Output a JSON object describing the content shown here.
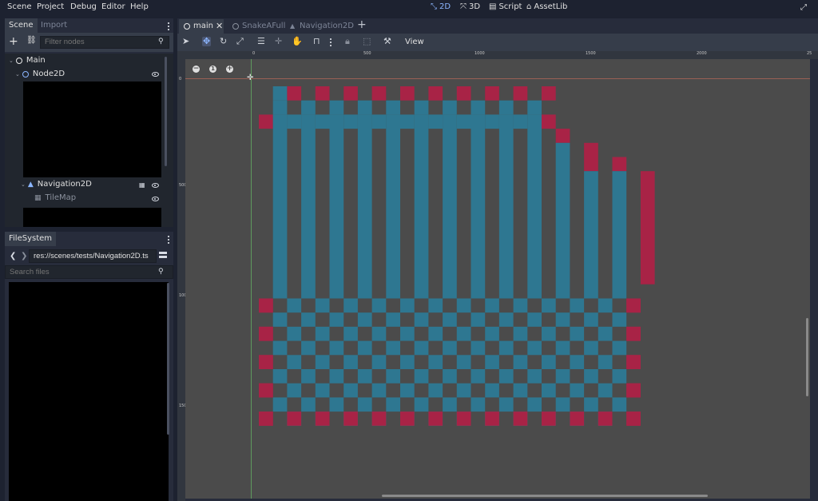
{
  "menubar": {
    "items": [
      "Scene",
      "Project",
      "Debug",
      "Editor",
      "Help"
    ],
    "workspaces": [
      {
        "label": "2D",
        "icon": "2d-icon",
        "active": true
      },
      {
        "label": "3D",
        "icon": "3d-icon",
        "active": false
      },
      {
        "label": "Script",
        "icon": "script-icon",
        "active": false
      },
      {
        "label": "AssetLib",
        "icon": "assetlib-icon",
        "active": false
      }
    ]
  },
  "scene_dock": {
    "tabs": [
      "Scene",
      "Import"
    ],
    "filter_placeholder": "Filter nodes",
    "tree": [
      {
        "label": "Main",
        "icon": "node-icon"
      },
      {
        "label": "Node2D",
        "icon": "node2d-icon"
      },
      {
        "label": "Navigation2D",
        "icon": "navigation2d-icon"
      },
      {
        "label": "TileMap",
        "icon": "tilemap-icon"
      }
    ]
  },
  "filesystem_dock": {
    "tab": "FileSystem",
    "path": "res://scenes/tests/Navigation2D.ts",
    "search_placeholder": "Search files"
  },
  "editor_tabs": {
    "tabs": [
      "main",
      "SnakeAFull",
      "Navigation2D"
    ],
    "active": "main"
  },
  "toolbar": {
    "view_label": "View"
  },
  "rulers": {
    "h_labels": [
      "0",
      "500",
      "1000",
      "1500",
      "2000",
      "25"
    ],
    "v_labels": [
      "0",
      "500",
      "1000",
      "1500"
    ]
  },
  "colors": {
    "accent": "#8cb6ff",
    "navigation_tile": "#2e7791",
    "obstacle_tile": "#a82346",
    "viewport_bg": "#4b4b4b"
  }
}
